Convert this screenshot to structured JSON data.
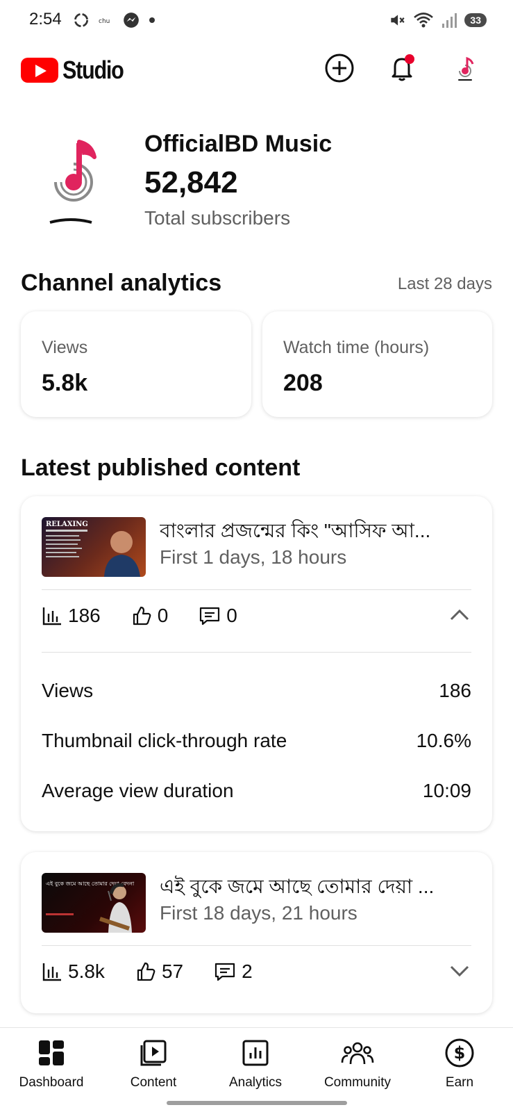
{
  "status_bar": {
    "time": "2:54",
    "battery": "33"
  },
  "header": {
    "brand": "Studio"
  },
  "channel": {
    "name": "OfficialBD Music",
    "subscribers": "52,842",
    "subscribers_label": "Total subscribers"
  },
  "analytics": {
    "title": "Channel analytics",
    "period": "Last 28 days",
    "metrics": [
      {
        "label": "Views",
        "value": "5.8k"
      },
      {
        "label": "Watch time (hours)",
        "value": "208"
      }
    ]
  },
  "latest": {
    "title": "Latest published content",
    "items": [
      {
        "title": "বাংলার প্রজন্মের কিং \"আসিফ আ...",
        "subtitle": "First 1 days, 18 hours",
        "views": "186",
        "likes": "0",
        "comments": "0",
        "thumb_text": "RELAXING",
        "expanded": true,
        "details": [
          {
            "label": "Views",
            "value": "186"
          },
          {
            "label": "Thumbnail click-through rate",
            "value": "10.6%"
          },
          {
            "label": "Average view duration",
            "value": "10:09"
          }
        ]
      },
      {
        "title": "এই বুকে জমে আছে তোমার দেয়া ...",
        "subtitle": "First 18 days, 21 hours",
        "views": "5.8k",
        "likes": "57",
        "comments": "2",
        "thumb_text": "এই বুকে জমে আছে তোমার দেয়া বেদনা",
        "expanded": false
      }
    ]
  },
  "nav": {
    "items": [
      {
        "label": "Dashboard",
        "icon": "dashboard-icon",
        "active": true
      },
      {
        "label": "Content",
        "icon": "content-icon"
      },
      {
        "label": "Analytics",
        "icon": "analytics-icon"
      },
      {
        "label": "Community",
        "icon": "community-icon"
      },
      {
        "label": "Earn",
        "icon": "earn-icon"
      }
    ]
  },
  "colors": {
    "brand_red": "#ff0000",
    "notification_dot": "#e8002c",
    "logo_pink": "#e0245e",
    "text_secondary": "#606060"
  }
}
